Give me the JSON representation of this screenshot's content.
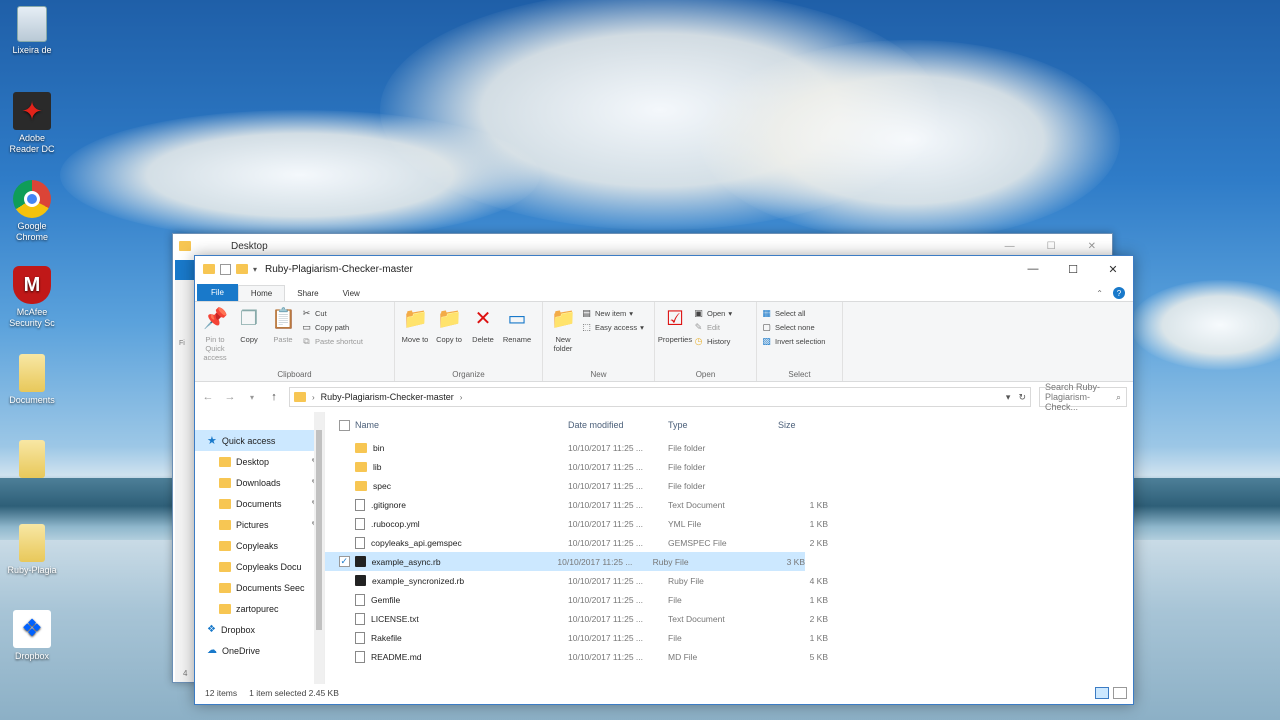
{
  "desktop": {
    "icons": [
      {
        "label": "Lixeira de",
        "icon": "recycle-bin-icon"
      },
      {
        "label": "Adobe Reader DC",
        "icon": "adobe-reader-icon"
      },
      {
        "label": "Google Chrome",
        "icon": "chrome-icon"
      },
      {
        "label": "McAfee Security Sc",
        "icon": "mcafee-icon"
      },
      {
        "label": "Documents",
        "icon": "folder-icon"
      },
      {
        "label": "",
        "icon": "folder-icon"
      },
      {
        "label": "Ruby-Plagia",
        "icon": "folder-icon"
      },
      {
        "label": "Dropbox",
        "icon": "dropbox-icon"
      }
    ]
  },
  "back_window": {
    "title": "Desktop",
    "left_strip_letter": "Fi",
    "bottom_char": "4"
  },
  "window": {
    "title": "Ruby-Plagiarism-Checker-master",
    "controls": {
      "minimize": "—",
      "maximize": "☐",
      "close": "✕"
    },
    "tabs": [
      {
        "label": "File",
        "kind": "file"
      },
      {
        "label": "Home",
        "kind": "active"
      },
      {
        "label": "Share",
        "kind": "normal"
      },
      {
        "label": "View",
        "kind": "normal"
      }
    ],
    "help": "?",
    "ribbon": {
      "clipboard": {
        "label": "Clipboard",
        "pin": "Pin to Quick access",
        "copy": "Copy",
        "paste": "Paste",
        "cut": "Cut",
        "copy_path": "Copy path",
        "paste_shortcut": "Paste shortcut"
      },
      "organize": {
        "label": "Organize",
        "move_to": "Move to",
        "copy_to": "Copy to",
        "delete": "Delete",
        "rename": "Rename"
      },
      "new": {
        "label": "New",
        "new_folder": "New folder",
        "new_item": "New item",
        "easy_access": "Easy access"
      },
      "open": {
        "label": "Open",
        "properties": "Properties",
        "open": "Open",
        "edit": "Edit",
        "history": "History"
      },
      "select": {
        "label": "Select",
        "select_all": "Select all",
        "select_none": "Select none",
        "invert": "Invert selection"
      }
    },
    "address": {
      "path": "Ruby-Plagiarism-Checker-master",
      "search_placeholder": "Search Ruby-Plagiarism-Check..."
    },
    "nav": [
      {
        "label": "Quick access",
        "icon": "star",
        "top": true,
        "pinned": false
      },
      {
        "label": "Desktop",
        "icon": "folder",
        "top": false,
        "pinned": true
      },
      {
        "label": "Downloads",
        "icon": "folder",
        "top": false,
        "pinned": true
      },
      {
        "label": "Documents",
        "icon": "folder",
        "top": false,
        "pinned": true
      },
      {
        "label": "Pictures",
        "icon": "folder",
        "top": false,
        "pinned": true
      },
      {
        "label": "Copyleaks",
        "icon": "folder",
        "top": false,
        "pinned": false
      },
      {
        "label": "Copyleaks Docu",
        "icon": "folder",
        "top": false,
        "pinned": false
      },
      {
        "label": "Documents Seec",
        "icon": "folder",
        "top": false,
        "pinned": false
      },
      {
        "label": "zartopurec",
        "icon": "folder",
        "top": false,
        "pinned": false
      },
      {
        "label": "Dropbox",
        "icon": "dropbox",
        "top": true,
        "pinned": false
      },
      {
        "label": "OneDrive",
        "icon": "cloud",
        "top": true,
        "pinned": false
      }
    ],
    "columns": {
      "name": "Name",
      "date": "Date modified",
      "type": "Type",
      "size": "Size"
    },
    "files": [
      {
        "name": "bin",
        "date": "10/10/2017 11:25 ...",
        "type": "File folder",
        "size": "",
        "icon": "folder"
      },
      {
        "name": "lib",
        "date": "10/10/2017 11:25 ...",
        "type": "File folder",
        "size": "",
        "icon": "folder"
      },
      {
        "name": "spec",
        "date": "10/10/2017 11:25 ...",
        "type": "File folder",
        "size": "",
        "icon": "folder"
      },
      {
        "name": ".gitignore",
        "date": "10/10/2017 11:25 ...",
        "type": "Text Document",
        "size": "1 KB",
        "icon": "doc"
      },
      {
        "name": ".rubocop.yml",
        "date": "10/10/2017 11:25 ...",
        "type": "YML File",
        "size": "1 KB",
        "icon": "doc"
      },
      {
        "name": "copyleaks_api.gemspec",
        "date": "10/10/2017 11:25 ...",
        "type": "GEMSPEC File",
        "size": "2 KB",
        "icon": "doc"
      },
      {
        "name": "example_async.rb",
        "date": "10/10/2017 11:25 ...",
        "type": "Ruby File",
        "size": "3 KB",
        "icon": "ruby",
        "selected": true
      },
      {
        "name": "example_syncronized.rb",
        "date": "10/10/2017 11:25 ...",
        "type": "Ruby File",
        "size": "4 KB",
        "icon": "ruby"
      },
      {
        "name": "Gemfile",
        "date": "10/10/2017 11:25 ...",
        "type": "File",
        "size": "1 KB",
        "icon": "doc"
      },
      {
        "name": "LICENSE.txt",
        "date": "10/10/2017 11:25 ...",
        "type": "Text Document",
        "size": "2 KB",
        "icon": "doc"
      },
      {
        "name": "Rakefile",
        "date": "10/10/2017 11:25 ...",
        "type": "File",
        "size": "1 KB",
        "icon": "doc"
      },
      {
        "name": "README.md",
        "date": "10/10/2017 11:25 ...",
        "type": "MD File",
        "size": "5 KB",
        "icon": "doc"
      }
    ],
    "status": {
      "count": "12 items",
      "selection": "1 item selected  2.45 KB"
    }
  }
}
